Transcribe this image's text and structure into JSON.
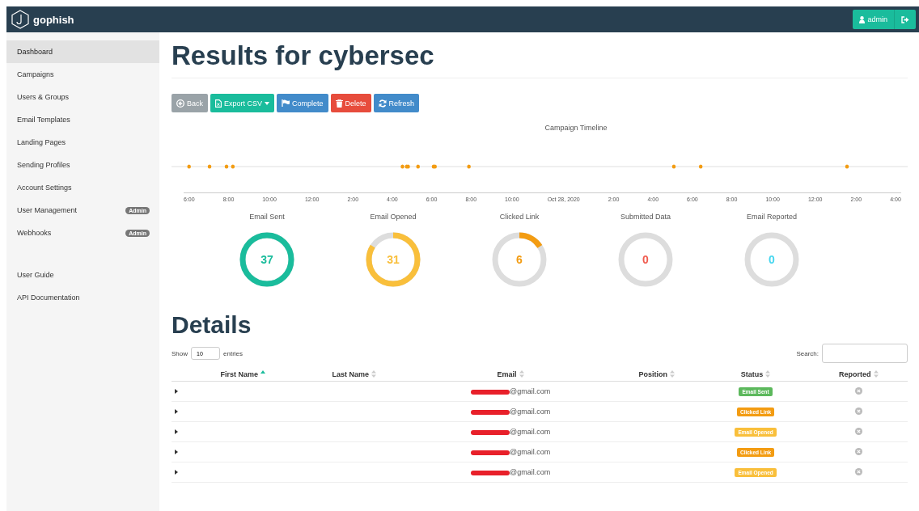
{
  "navbar": {
    "brand": "gophish",
    "user_button": "admin"
  },
  "sidebar": {
    "items": [
      {
        "label": "Dashboard",
        "selected": true
      },
      {
        "label": "Campaigns",
        "selected": false
      },
      {
        "label": "Users & Groups",
        "selected": false
      },
      {
        "label": "Email Templates",
        "selected": false
      },
      {
        "label": "Landing Pages",
        "selected": false
      },
      {
        "label": "Sending Profiles",
        "selected": false
      },
      {
        "label": "Account Settings",
        "selected": false
      },
      {
        "label": "User Management",
        "selected": false,
        "badge": "Admin"
      },
      {
        "label": "Webhooks",
        "selected": false,
        "badge": "Admin"
      }
    ],
    "links": [
      "User Guide",
      "API Documentation"
    ]
  },
  "page": {
    "title": "Results for cybersec"
  },
  "buttons": [
    {
      "kind": "back",
      "label": "Back",
      "disabled": true
    },
    {
      "kind": "export",
      "label": "Export CSV",
      "disabled": false
    },
    {
      "kind": "complete",
      "label": "Complete",
      "disabled": false
    },
    {
      "kind": "delete",
      "label": "Delete",
      "disabled": false
    },
    {
      "kind": "refresh",
      "label": "Refresh",
      "disabled": false
    }
  ],
  "timeline": {
    "title": "Campaign Timeline",
    "ticks": [
      "6:00",
      "8:00",
      "10:00",
      "12:00",
      "2:00",
      "4:00",
      "6:00",
      "8:00",
      "10:00",
      "Oct 28, 2020",
      "2:00",
      "4:00",
      "6:00",
      "8:00",
      "10:00",
      "12:00",
      "2:00",
      "4:00"
    ]
  },
  "stats": [
    {
      "label": "Email Sent",
      "value": "37",
      "level": 1,
      "color": "#1abc9c"
    },
    {
      "label": "Email Opened",
      "value": "31",
      "level": 0.84,
      "color": "#f9bf3b"
    },
    {
      "label": "Clicked Link",
      "value": "6",
      "level": 0.16,
      "color": "#f39c12"
    },
    {
      "label": "Submitted Data",
      "value": "0",
      "level": 0,
      "color": "#f05b4f"
    },
    {
      "label": "Email Reported",
      "value": "0",
      "level": 0,
      "color": "#45d6ef"
    }
  ],
  "details": {
    "title": "Details",
    "show_label": "Show",
    "entries_value": "10",
    "entries_label": "entries",
    "search_label": "Search:",
    "columns": [
      {
        "label": "First Name",
        "sorted": true
      },
      {
        "label": "Last Name",
        "sorted": false
      },
      {
        "label": "Email",
        "sorted": false
      },
      {
        "label": "Position",
        "sorted": false
      },
      {
        "label": "Status",
        "sorted": false
      },
      {
        "label": "Reported",
        "sorted": false
      }
    ],
    "rows": [
      {
        "email": "@gmail.com",
        "status": "Email Sent",
        "color": "#5cb85c"
      },
      {
        "email": "@gmail.com",
        "status": "Clicked Link",
        "color": "#f39c12"
      },
      {
        "email": "@gmail.com",
        "status": "Email Opened",
        "color": "#f9bf3b"
      },
      {
        "email": "@gmail.com",
        "status": "Clicked Link",
        "color": "#f39c12"
      },
      {
        "email": "@gmail.com",
        "status": "Email Opened",
        "color": "#f9bf3b"
      }
    ]
  }
}
